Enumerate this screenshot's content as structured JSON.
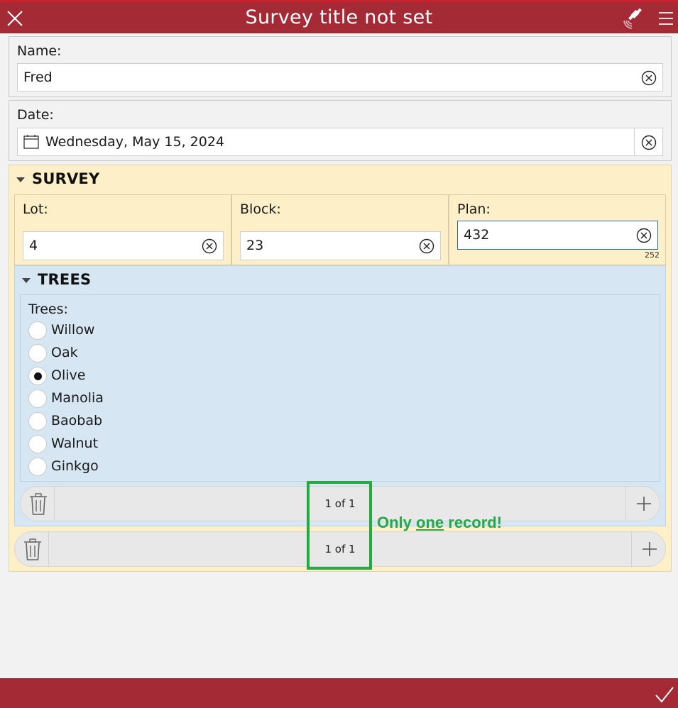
{
  "header": {
    "title": "Survey title not set",
    "close_icon": "close-icon",
    "gps_icon": "satellite-gps-icon",
    "menu_icon": "hamburger-menu-icon"
  },
  "colors": {
    "header_bg": "#a42a36",
    "group_bg": "#fdf0c9",
    "repeat_bg": "#d7e6f3",
    "page_bg": "#f2f2f2",
    "annotation": "#28a745"
  },
  "name_question": {
    "label": "Name:",
    "value": "Fred"
  },
  "date_question": {
    "label": "Date:",
    "value": "Wednesday, May 15, 2024",
    "icon": "calendar-icon"
  },
  "survey_group": {
    "title": "SURVEY",
    "lot": {
      "label": "Lot:",
      "value": "4"
    },
    "block": {
      "label": "Block:",
      "value": "23"
    },
    "plan": {
      "label": "Plan:",
      "value": "432",
      "remaining": "252"
    }
  },
  "trees_repeat": {
    "title": "TREES",
    "question_label": "Trees:",
    "options": [
      "Willow",
      "Oak",
      "Olive",
      "Manolia",
      "Baobab",
      "Walnut",
      "Ginkgo"
    ],
    "selected": "Olive",
    "record_count": "1 of 1"
  },
  "survey_repeat": {
    "record_count": "1 of 1"
  },
  "annotation": {
    "before": "Only ",
    "emph": "one",
    "after": " record!"
  },
  "footer": {
    "submit_icon": "checkmark-icon"
  }
}
